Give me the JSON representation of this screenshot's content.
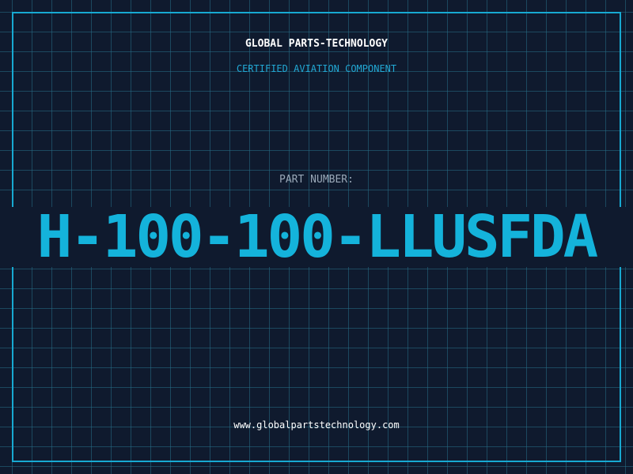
{
  "header": {
    "company": "GLOBAL PARTS-TECHNOLOGY",
    "tagline": "CERTIFIED AVIATION COMPONENT"
  },
  "part": {
    "label": "PART NUMBER:",
    "number": "H-100-100-LLUSFDA"
  },
  "footer": {
    "website": "www.globalpartstechnology.com"
  },
  "colors": {
    "background": "#0f1a2e",
    "grid": "#266e87",
    "accent": "#17a9d1",
    "text": "#ffffff",
    "muted": "#9aa8b8"
  }
}
